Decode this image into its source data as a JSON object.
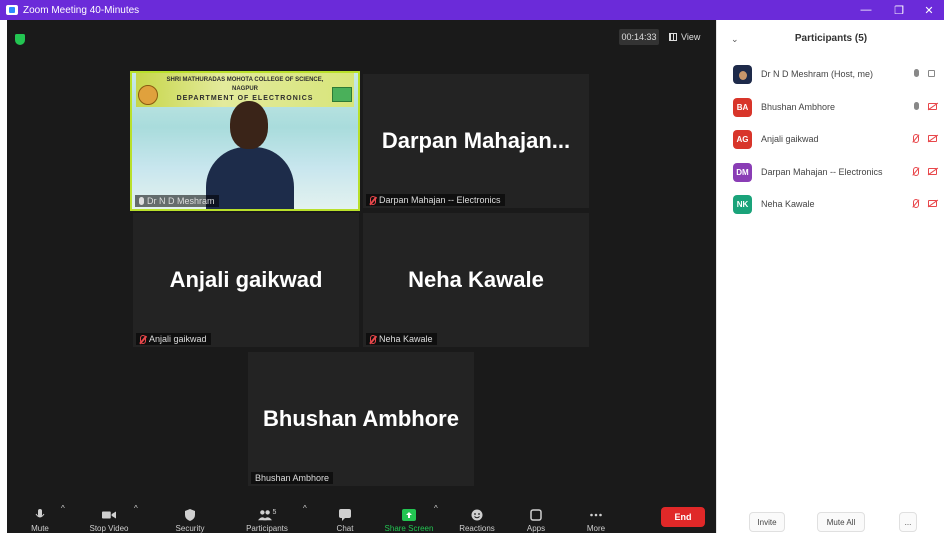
{
  "window": {
    "title": "Zoom Meeting 40-Minutes",
    "minimize": "—",
    "restore": "❐",
    "close": "✕"
  },
  "meeting": {
    "timer": "00:14:33",
    "view_label": "View",
    "tiles": [
      {
        "big_name": "",
        "label": "Dr N D Meshram",
        "banner_line1": "SHRI MATHURADAS MOHOTA COLLEGE OF SCIENCE,",
        "banner_line2": "NAGPUR",
        "banner_dept": "DEPARTMENT OF ELECTRONICS"
      },
      {
        "big_name": "Darpan Mahajan...",
        "label": "Darpan Mahajan -- Electronics"
      },
      {
        "big_name": "Anjali gaikwad",
        "label": "Anjali gaikwad"
      },
      {
        "big_name": "Neha Kawale",
        "label": "Neha Kawale"
      },
      {
        "big_name": "Bhushan Ambhore",
        "label": "Bhushan Ambhore"
      }
    ]
  },
  "toolbar": {
    "mute": "Mute",
    "stop_video": "Stop Video",
    "security": "Security",
    "participants": "Participants",
    "participants_count": "5",
    "chat": "Chat",
    "share_screen": "Share Screen",
    "reactions": "Reactions",
    "apps": "Apps",
    "more": "More",
    "end": "End",
    "share_color": "#23c552",
    "end_color": "#e02828"
  },
  "participants_panel": {
    "title": "Participants (5)",
    "list": [
      {
        "initials": "",
        "name": "Dr N D Meshram (Host, me)",
        "color": "#1e2a4a"
      },
      {
        "initials": "BA",
        "name": "Bhushan Ambhore",
        "color": "#d8352a"
      },
      {
        "initials": "AG",
        "name": "Anjali gaikwad",
        "color": "#d8352a"
      },
      {
        "initials": "DM",
        "name": "Darpan Mahajan -- Electronics",
        "color": "#8a3db5"
      },
      {
        "initials": "NK",
        "name": "Neha Kawale",
        "color": "#1aa37a"
      }
    ],
    "invite": "Invite",
    "mute_all": "Mute All",
    "more": "..."
  }
}
